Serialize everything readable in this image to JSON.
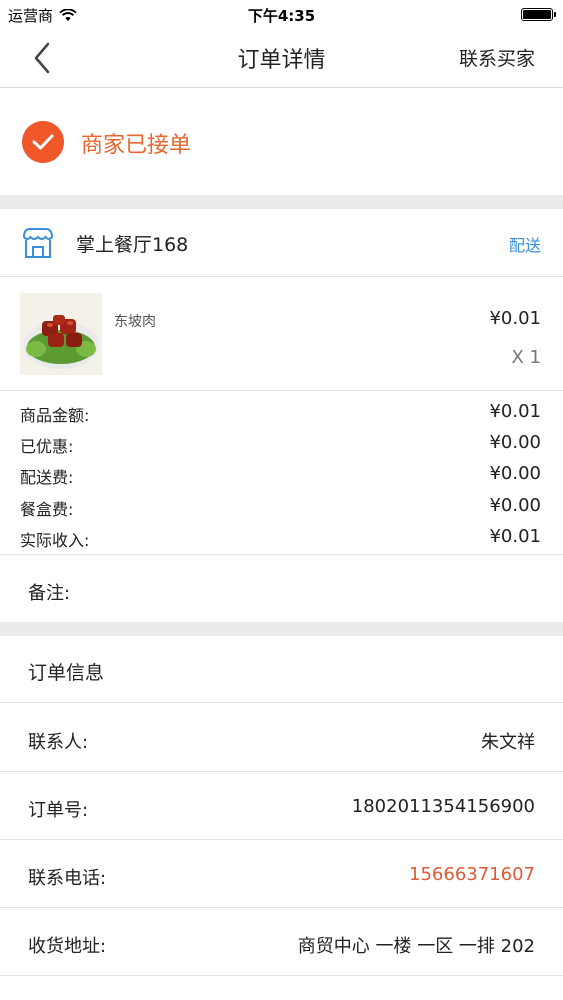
{
  "status_bar": {
    "carrier": "运营商",
    "time": "下午4:35"
  },
  "nav": {
    "title": "订单详情",
    "contact_label": "联系买家"
  },
  "order_status": {
    "text": "商家已接单"
  },
  "shop": {
    "name": "掌上餐厅168",
    "delivery_label": "配送"
  },
  "item": {
    "name": "东坡肉",
    "price": "¥0.01",
    "quantity": "X 1"
  },
  "amounts": [
    {
      "label": "商品金额:",
      "value": "¥0.01"
    },
    {
      "label": "已优惠:",
      "value": "¥0.00"
    },
    {
      "label": "配送费:",
      "value": "¥0.00"
    },
    {
      "label": "餐盒费:",
      "value": "¥0.00"
    },
    {
      "label": "实际收入:",
      "value": "¥0.01"
    }
  ],
  "remark": {
    "label": "备注:"
  },
  "order_info": {
    "header": "订单信息",
    "rows": [
      {
        "label": "联系人:",
        "value": "朱文祥"
      },
      {
        "label": "订单号:",
        "value": "1802011354156900"
      },
      {
        "label": "联系电话:",
        "value": "15666371607"
      },
      {
        "label": "收货地址:",
        "value": "商贸中心 一楼 一区 一排 202"
      }
    ]
  },
  "colors": {
    "accent": "#f0582a",
    "status_text": "#e8662f",
    "link": "#3a8fd8",
    "phone": "#e05a35"
  }
}
